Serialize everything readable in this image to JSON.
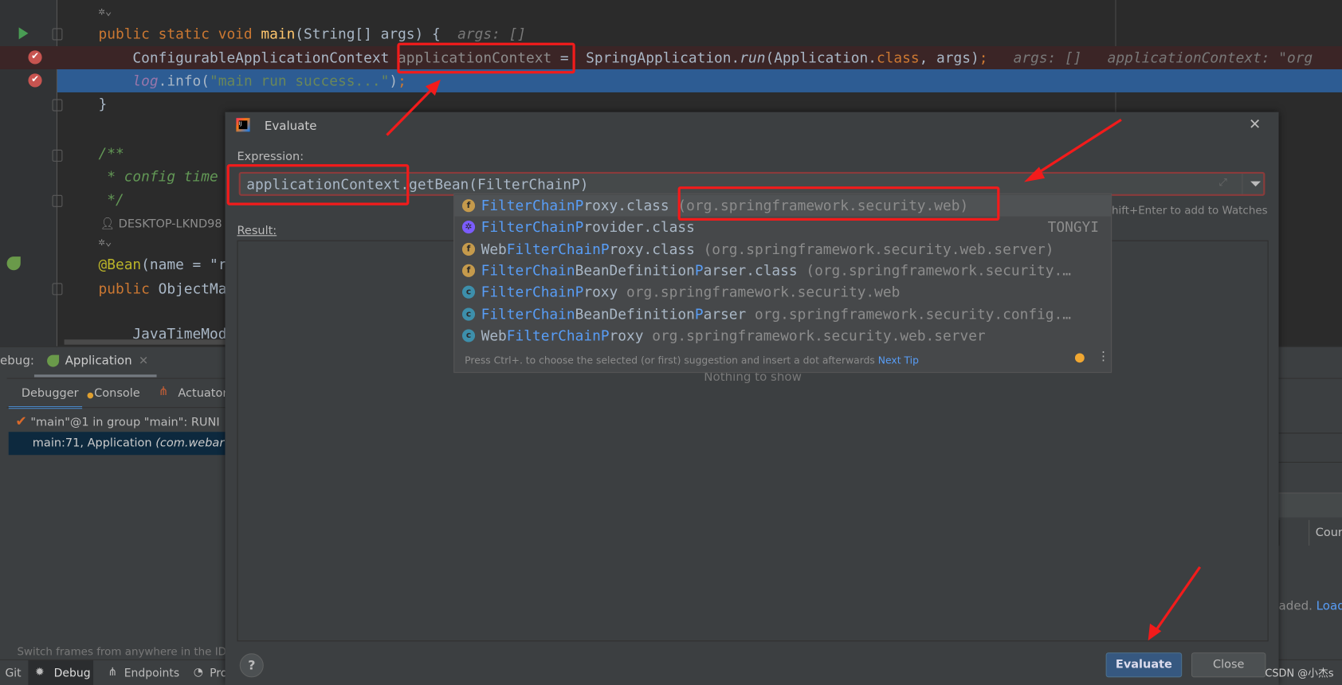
{
  "colors": {
    "accent": "#365880",
    "annotation": "#f21b1b",
    "match": "#589df6",
    "editor_bg": "#2b2b2b",
    "dialog_bg": "#3c3f41"
  },
  "editor": {
    "lines": [
      {
        "tokens": [
          [
            "kw",
            "public static void "
          ],
          [
            "fn",
            "main"
          ],
          [
            "txt",
            "(String[] args) {  "
          ],
          [
            "hint",
            "args: []"
          ]
        ]
      },
      {
        "tokens": [
          [
            "txt",
            "    ConfigurableApplicationContext "
          ],
          [
            "pk",
            "applicationContext"
          ],
          [
            "txt",
            " =  SpringApplication."
          ],
          [
            "fi",
            "run"
          ],
          [
            "txt",
            "(Application."
          ],
          [
            "kw",
            "class"
          ],
          [
            "txt",
            ", args)"
          ],
          [
            "kw",
            ";"
          ],
          [
            "hint",
            "   args: []   applicationContext: \"org"
          ]
        ]
      },
      {
        "tokens": [
          [
            "txt",
            "    "
          ],
          [
            "fld",
            "log"
          ],
          [
            "txt",
            ".info("
          ],
          [
            "str",
            "\"main run success...\""
          ],
          [
            "txt",
            ")"
          ],
          [
            "kw",
            ";"
          ]
        ]
      },
      {
        "tokens": [
          [
            "txt",
            "}"
          ]
        ]
      },
      {
        "tokens": [
          [
            "cm",
            "/**"
          ]
        ]
      },
      {
        "tokens": [
          [
            "cm",
            " * config time"
          ]
        ]
      },
      {
        "tokens": [
          [
            "cm",
            " */"
          ]
        ]
      },
      {
        "tokens": [
          [
            "ann",
            "@Bean"
          ],
          [
            "txt",
            "(name = \"r"
          ]
        ]
      },
      {
        "tokens": [
          [
            "kw",
            "public "
          ],
          [
            "txt",
            "ObjectMa"
          ]
        ]
      },
      {
        "tokens": [
          [
            "txt",
            "    JavaTimeMod"
          ]
        ]
      }
    ],
    "author": "DESKTOP-LKND98"
  },
  "debug_panel": {
    "label": "ebug:",
    "session_tab": "Application",
    "tabs": [
      "Debugger",
      "Console",
      "Actuator"
    ],
    "thread": "\"main\"@1 in group \"main\": RUNI",
    "frame_name": "main:71, Application ",
    "frame_pkg": "(com.webar",
    "hint": "Switch frames from anywhere in the IDE w",
    "right_header": "Cour",
    "right_text": "aded. ",
    "right_link": "Load"
  },
  "bottom_bar": [
    "Git",
    "Debug",
    "Endpoints",
    "Pro"
  ],
  "dialog": {
    "title": "Evaluate",
    "expression_label": "Expression:",
    "expression_value": "applicationContext.getBean(FilterChainP)",
    "watches_hint": "+Shift+Enter to add to Watches",
    "result_label": "Result:",
    "result_empty": "Nothing to show",
    "evaluate_button": "Evaluate",
    "close_button": "Close"
  },
  "completion": {
    "items": [
      {
        "icon": "f",
        "pre": "",
        "match": "FilterChainP",
        "rest": "roxy.class",
        "pkg": " (org.springframework.security.web)",
        "right": ""
      },
      {
        "icon": "tongyi",
        "pre": "",
        "match": "FilterChainP",
        "rest": "rovider.class",
        "pkg": "",
        "right": "TONGYI"
      },
      {
        "icon": "f",
        "pre": "Web",
        "match": "FilterChainP",
        "rest": "roxy.class",
        "pkg": " (org.springframework.security.web.server)",
        "right": ""
      },
      {
        "icon": "f",
        "pre": "",
        "match": "FilterChain",
        "rest": "BeanDefinition",
        "match2": "P",
        "rest2": "arser.class",
        "pkg": " (org.springframework.security.…",
        "right": ""
      },
      {
        "icon": "c",
        "pre": "",
        "match": "FilterChainP",
        "rest": "roxy",
        "pkg": " org.springframework.security.web",
        "right": ""
      },
      {
        "icon": "c",
        "pre": "",
        "match": "FilterChain",
        "rest": "BeanDefinition",
        "match2": "P",
        "rest2": "arser",
        "pkg": " org.springframework.security.config.…",
        "right": ""
      },
      {
        "icon": "c",
        "pre": "Web",
        "match": "FilterChainP",
        "rest": "roxy",
        "pkg": " org.springframework.security.web.server",
        "right": ""
      }
    ],
    "footer": "Press Ctrl+. to choose the selected (or first) suggestion and insert a dot afterwards",
    "footer_link": "Next Tip"
  },
  "watermark": "CSDN @小杰s"
}
